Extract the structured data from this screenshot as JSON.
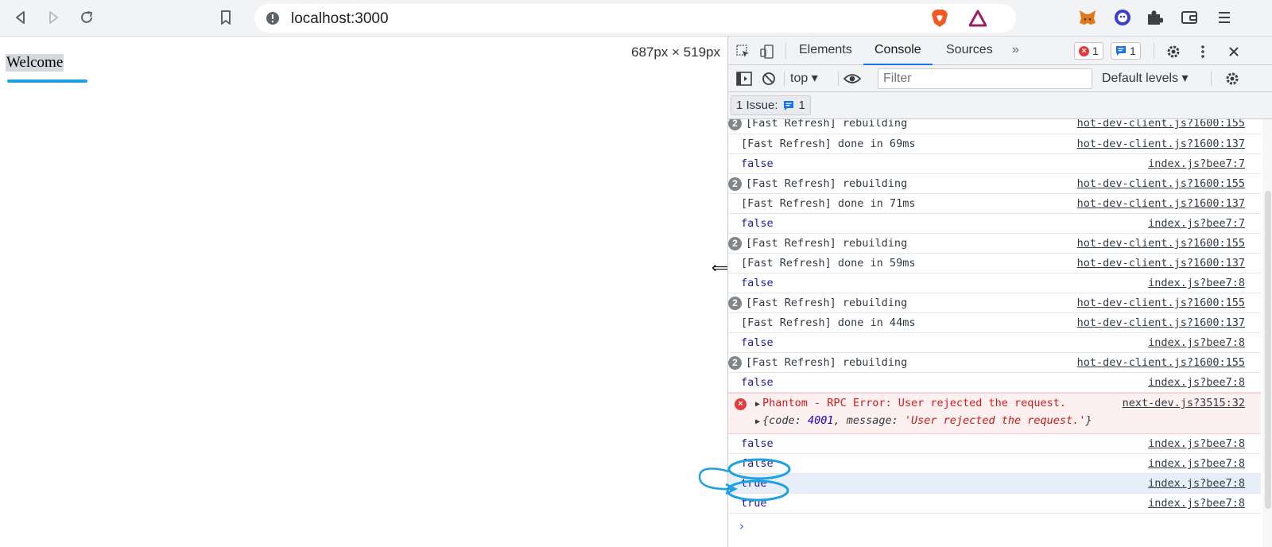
{
  "browser": {
    "url": "localhost:3000"
  },
  "page": {
    "welcome_text": "Welcome",
    "dimensions": "687px × 519px"
  },
  "devtools": {
    "tabs": [
      "Elements",
      "Console",
      "Sources"
    ],
    "active_tab": "Console",
    "more_tabs": "»",
    "error_count": "1",
    "info_count": "1",
    "context": "top ▾",
    "filter_placeholder": "Filter",
    "levels": "Default levels ▾",
    "issues_label": "1 Issue:",
    "issues_count": "1"
  },
  "console": {
    "rows": [
      {
        "count": "2",
        "msg": "[Fast Refresh] rebuilding",
        "src": "hot-dev-client.js?1600:155"
      },
      {
        "msg": "[Fast Refresh] done in 69ms",
        "src": "hot-dev-client.js?1600:137"
      },
      {
        "msg": "false",
        "src": "index.js?bee7:7"
      },
      {
        "count": "2",
        "msg": "[Fast Refresh] rebuilding",
        "src": "hot-dev-client.js?1600:155"
      },
      {
        "msg": "[Fast Refresh] done in 71ms",
        "src": "hot-dev-client.js?1600:137"
      },
      {
        "msg": "false",
        "src": "index.js?bee7:7"
      },
      {
        "count": "2",
        "msg": "[Fast Refresh] rebuilding",
        "src": "hot-dev-client.js?1600:155"
      },
      {
        "msg": "[Fast Refresh] done in 59ms",
        "src": "hot-dev-client.js?1600:137"
      },
      {
        "msg": "false",
        "src": "index.js?bee7:8"
      },
      {
        "count": "2",
        "msg": "[Fast Refresh] rebuilding",
        "src": "hot-dev-client.js?1600:155"
      },
      {
        "msg": "[Fast Refresh] done in 44ms",
        "src": "hot-dev-client.js?1600:137"
      },
      {
        "msg": "false",
        "src": "index.js?bee7:8"
      },
      {
        "count": "2",
        "msg": "[Fast Refresh] rebuilding",
        "src": "hot-dev-client.js?1600:155"
      },
      {
        "msg": "false",
        "src": "index.js?bee7:8"
      }
    ],
    "error": {
      "msg": "Phantom - RPC Error: User rejected the request.",
      "src": "next-dev.js?3515:32",
      "detail_code_key": "{code: ",
      "detail_code_val": "4001",
      "detail_msg_key": ", message: ",
      "detail_msg_val": "'User rejected the request.'",
      "detail_close": "}"
    },
    "tail_rows": [
      {
        "msg": "false",
        "src": "index.js?bee7:8"
      },
      {
        "msg": "false",
        "src": "index.js?bee7:8"
      },
      {
        "msg": "true",
        "src": "index.js?bee7:8",
        "selected": true
      },
      {
        "msg": "true",
        "src": "index.js?bee7:8"
      }
    ],
    "prompt": "›"
  },
  "colors": {
    "accent": "#1a73e8",
    "annotation": "#1fa0e0",
    "error": "#d01c1c"
  }
}
